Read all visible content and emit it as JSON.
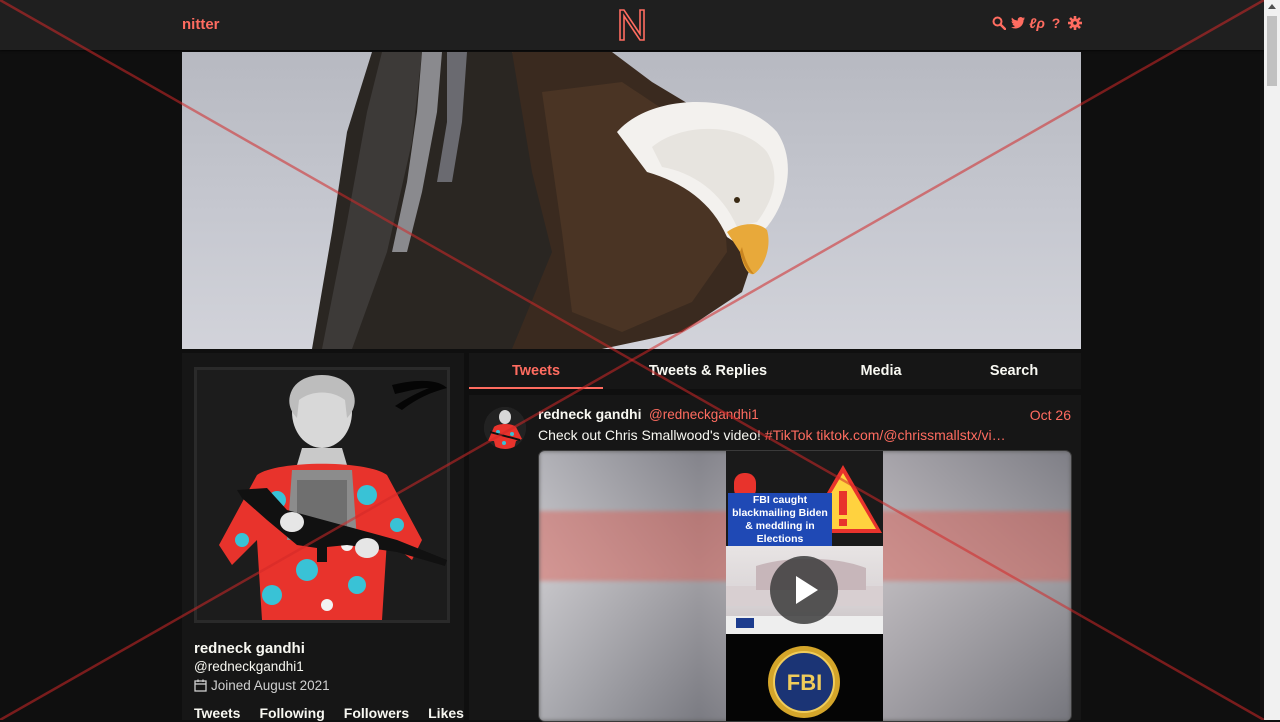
{
  "navbar": {
    "brand": "nitter",
    "logo_letter": "N",
    "icons": [
      "search-icon",
      "twitter-icon",
      "rss-icon",
      "help-icon",
      "settings-icon"
    ]
  },
  "profile": {
    "fullname": "redneck gandhi",
    "username": "@redneckgandhi1",
    "joined": "Joined August 2021",
    "stats": [
      "Tweets",
      "Following",
      "Followers",
      "Likes"
    ]
  },
  "tabs": [
    "Tweets",
    "Tweets & Replies",
    "Media",
    "Search"
  ],
  "tweet": {
    "fullname": "redneck gandhi",
    "username": "@redneckgandhi1",
    "date": "Oct 26",
    "text": "Check out Chris Smallwood's video! ",
    "hashtag": "#TikTok",
    "link": "tiktok.com/@chrissmallstx/vi…",
    "video_caption": "FBI caught blackmailing Biden & meddling in Elections",
    "fbi_badge": "FBI"
  },
  "colors": {
    "accent": "#ff6c60",
    "background": "#0f0f0f",
    "panel": "#161616"
  }
}
